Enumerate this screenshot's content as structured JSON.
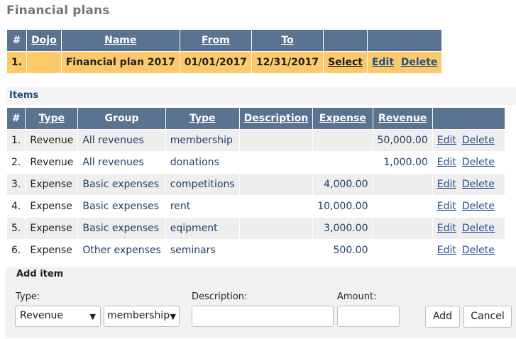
{
  "page": {
    "title": "Financial plans"
  },
  "plans": {
    "headers": {
      "idx": "#",
      "dojo": "Dojo",
      "name": "Name",
      "from": "From",
      "to": "To"
    },
    "rows": [
      {
        "idx": "1.",
        "dojo": "",
        "name": "Financial plan 2017",
        "from": "01/01/2017",
        "to": "12/31/2017",
        "select": "Select",
        "edit": "Edit",
        "delete": "Delete"
      }
    ],
    "selected_row_color": "#fdc969",
    "header_color": "#5a7391"
  },
  "items": {
    "label": "Items",
    "headers": {
      "idx": "#",
      "type": "Type",
      "group": "Group",
      "subtype": "Type",
      "description": "Description",
      "expense": "Expense",
      "revenue": "Revenue"
    },
    "rows": [
      {
        "idx": "1.",
        "type": "Revenue",
        "group": "All revenues",
        "subtype": "membership",
        "description": "",
        "expense": "",
        "revenue": "50,000.00",
        "edit": "Edit",
        "delete": "Delete"
      },
      {
        "idx": "2.",
        "type": "Revenue",
        "group": "All revenues",
        "subtype": "donations",
        "description": "",
        "expense": "",
        "revenue": "1,000.00",
        "edit": "Edit",
        "delete": "Delete"
      },
      {
        "idx": "3.",
        "type": "Expense",
        "group": "Basic expenses",
        "subtype": "competitions",
        "description": "",
        "expense": "4,000.00",
        "revenue": "",
        "edit": "Edit",
        "delete": "Delete"
      },
      {
        "idx": "4.",
        "type": "Expense",
        "group": "Basic expenses",
        "subtype": "rent",
        "description": "",
        "expense": "10,000.00",
        "revenue": "",
        "edit": "Edit",
        "delete": "Delete"
      },
      {
        "idx": "5.",
        "type": "Expense",
        "group": "Basic expenses",
        "subtype": "eqipment",
        "description": "",
        "expense": "3,000.00",
        "revenue": "",
        "edit": "Edit",
        "delete": "Delete"
      },
      {
        "idx": "6.",
        "type": "Expense",
        "group": "Other expenses",
        "subtype": "seminars",
        "description": "",
        "expense": "500.00",
        "revenue": "",
        "edit": "Edit",
        "delete": "Delete"
      }
    ]
  },
  "add_item": {
    "title": "Add item",
    "type_label": "Type:",
    "type_value": "Revenue",
    "subtype_value": "membership",
    "description_label": "Description:",
    "description_value": "",
    "amount_label": "Amount:",
    "amount_value": "",
    "add_button": "Add",
    "cancel_button": "Cancel"
  },
  "icons": {
    "dropdown": "chevron-down-icon"
  }
}
